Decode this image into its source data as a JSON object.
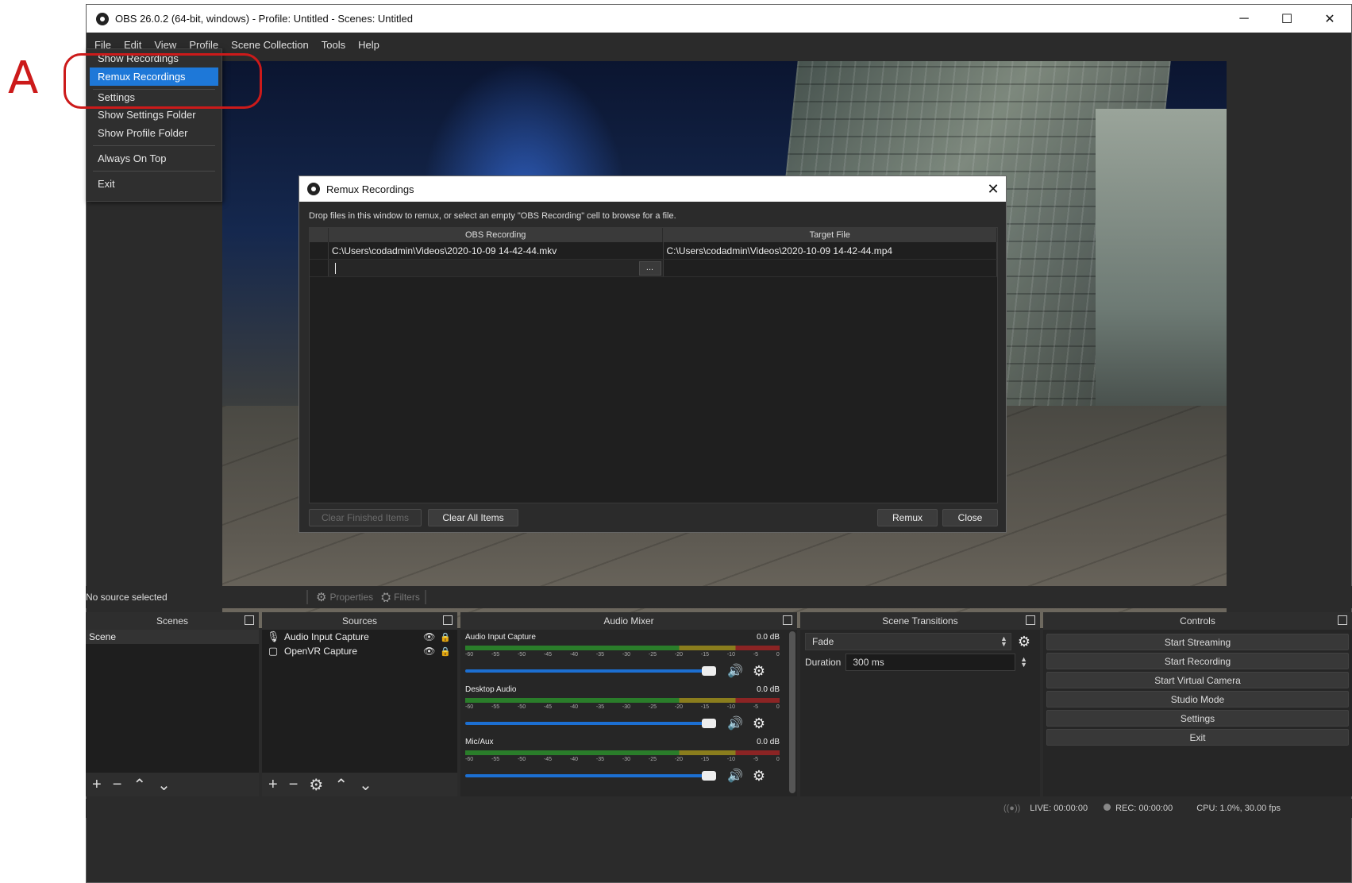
{
  "annotation": {
    "letter": "A"
  },
  "window": {
    "title": "OBS 26.0.2 (64-bit, windows) - Profile: Untitled - Scenes: Untitled",
    "minimize": "─",
    "maximize": "☐",
    "close": "✕"
  },
  "menubar": [
    "File",
    "Edit",
    "View",
    "Profile",
    "Scene Collection",
    "Tools",
    "Help"
  ],
  "file_menu": {
    "show_recordings": "Show Recordings",
    "remux_recordings": "Remux Recordings",
    "settings": "Settings",
    "show_settings_folder": "Show Settings Folder",
    "show_profile_folder": "Show Profile Folder",
    "always_on_top": "Always On Top",
    "exit": "Exit"
  },
  "remux_dialog": {
    "title": "Remux Recordings",
    "close": "✕",
    "hint": "Drop files in this window to remux, or select an empty \"OBS Recording\" cell to browse for a file.",
    "columns": {
      "recording": "OBS Recording",
      "target": "Target File"
    },
    "rows": [
      {
        "recording": "C:\\Users\\codadmin\\Videos\\2020-10-09 14-42-44.mkv",
        "target": "C:\\Users\\codadmin\\Videos\\2020-10-09 14-42-44.mp4"
      }
    ],
    "browse": "...",
    "buttons": {
      "clear_finished": "Clear Finished Items",
      "clear_all": "Clear All Items",
      "remux": "Remux",
      "close": "Close"
    }
  },
  "source_toolbar": {
    "no_source": "No source selected",
    "properties": "Properties",
    "filters": "Filters"
  },
  "docks": {
    "scenes": {
      "title": "Scenes",
      "items": [
        "Scene"
      ]
    },
    "sources": {
      "title": "Sources",
      "items": [
        {
          "name": "Audio Input Capture",
          "icon": "microphone-icon"
        },
        {
          "name": "OpenVR Capture",
          "icon": "window-icon"
        }
      ]
    },
    "mixer": {
      "title": "Audio Mixer",
      "channels": [
        {
          "name": "Audio Input Capture",
          "level": "0.0 dB",
          "volume_fraction": 1.0
        },
        {
          "name": "Desktop Audio",
          "level": "0.0 dB",
          "volume_fraction": 1.0
        },
        {
          "name": "Mic/Aux",
          "level": "0.0 dB",
          "volume_fraction": 1.0
        }
      ],
      "ticks": [
        "-60",
        "-55",
        "-50",
        "-45",
        "-40",
        "-35",
        "-30",
        "-25",
        "-20",
        "-15",
        "-10",
        "-5",
        "0"
      ]
    },
    "transitions": {
      "title": "Scene Transitions",
      "selected": "Fade",
      "duration_label": "Duration",
      "duration_value": "300 ms"
    },
    "controls": {
      "title": "Controls",
      "buttons": [
        "Start Streaming",
        "Start Recording",
        "Start Virtual Camera",
        "Studio Mode",
        "Settings",
        "Exit"
      ]
    }
  },
  "statusbar": {
    "live": "LIVE: 00:00:00",
    "rec": "REC: 00:00:00",
    "cpu": "CPU: 1.0%, 30.00 fps"
  }
}
